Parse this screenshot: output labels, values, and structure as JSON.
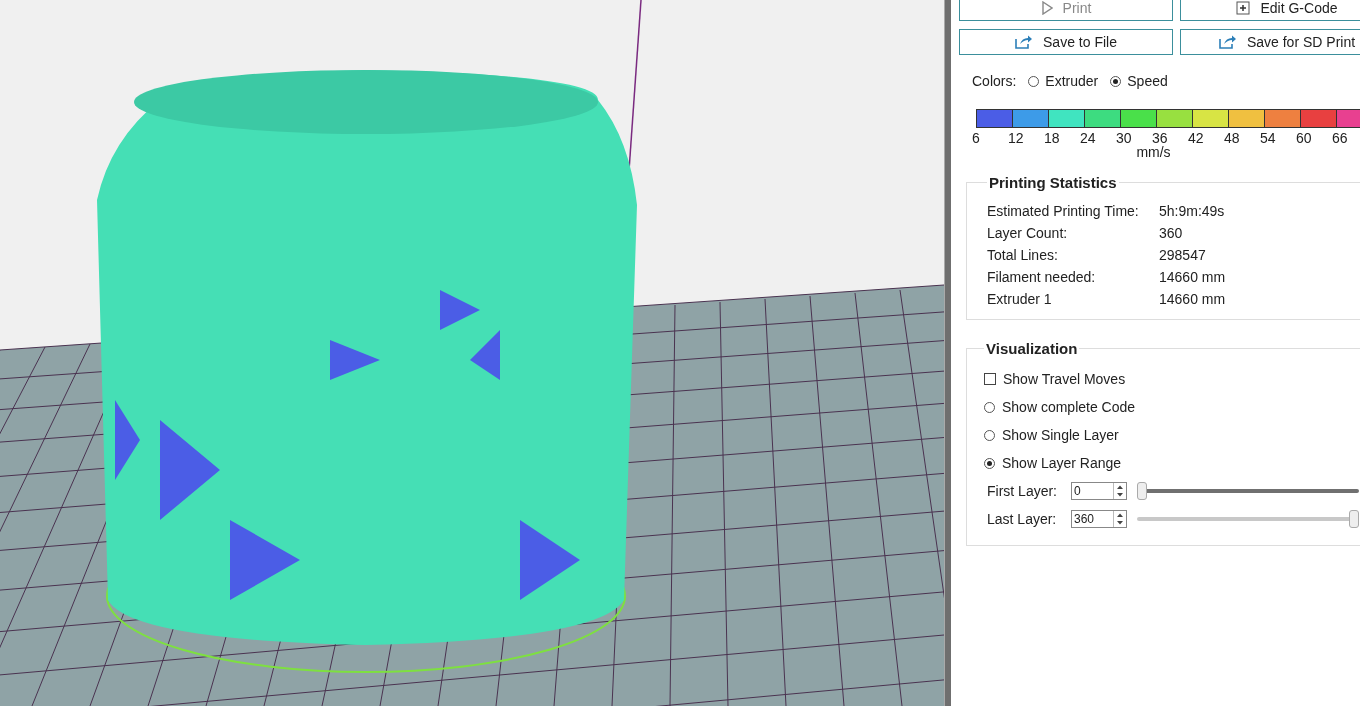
{
  "toolbar": {
    "buttons": [
      {
        "label": "Print"
      },
      {
        "label": "Edit G-Code"
      },
      {
        "label": "Save to File"
      },
      {
        "label": "Save for SD Print"
      }
    ]
  },
  "colors": {
    "label": "Colors:",
    "options": [
      {
        "label": "Extruder",
        "selected": false
      },
      {
        "label": "Speed",
        "selected": true
      }
    ]
  },
  "speed_legend": {
    "unit": "mm/s",
    "swatches": [
      {
        "color": "#4b5de6",
        "label": "6"
      },
      {
        "color": "#3d9be8",
        "label": "12"
      },
      {
        "color": "#40e4c0",
        "label": "18"
      },
      {
        "color": "#3ddc80",
        "label": "24"
      },
      {
        "color": "#4ae04a",
        "label": "30"
      },
      {
        "color": "#98e040",
        "label": "36"
      },
      {
        "color": "#d8e444",
        "label": "42"
      },
      {
        "color": "#f0c040",
        "label": "48"
      },
      {
        "color": "#ee8040",
        "label": "54"
      },
      {
        "color": "#e84040",
        "label": "60"
      },
      {
        "color": "#e84090",
        "label": "66"
      }
    ]
  },
  "statistics": {
    "title": "Printing Statistics",
    "rows": [
      {
        "label": "Estimated Printing Time:",
        "value": "5h:9m:49s"
      },
      {
        "label": "Layer Count:",
        "value": "360"
      },
      {
        "label": "Total Lines:",
        "value": "298547"
      },
      {
        "label": "Filament needed:",
        "value": "14660 mm"
      },
      {
        "label": "Extruder 1",
        "value": "14660 mm"
      }
    ]
  },
  "visualization": {
    "title": "Visualization",
    "options": [
      {
        "kind": "checkbox",
        "label": "Show Travel Moves",
        "checked": false
      },
      {
        "kind": "radio",
        "label": "Show complete Code",
        "selected": false
      },
      {
        "kind": "radio",
        "label": "Show Single Layer",
        "selected": false
      },
      {
        "kind": "radio",
        "label": "Show Layer Range",
        "selected": true
      }
    ],
    "layers": [
      {
        "label": "First Layer:",
        "value": "0",
        "level": 0
      },
      {
        "label": "Last Layer:",
        "value": "360",
        "level": 1
      }
    ]
  }
}
